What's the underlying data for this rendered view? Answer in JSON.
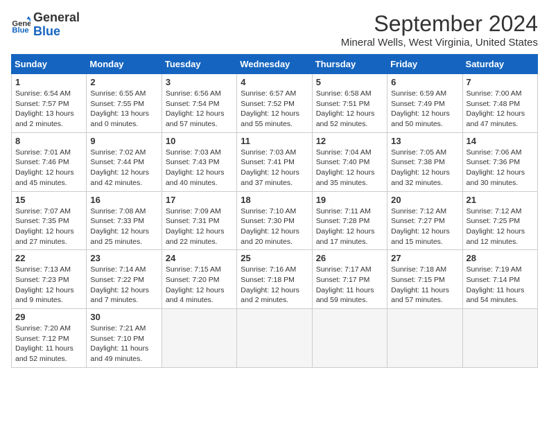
{
  "logo": {
    "line1": "General",
    "line2": "Blue"
  },
  "title": "September 2024",
  "subtitle": "Mineral Wells, West Virginia, United States",
  "days_of_week": [
    "Sunday",
    "Monday",
    "Tuesday",
    "Wednesday",
    "Thursday",
    "Friday",
    "Saturday"
  ],
  "weeks": [
    [
      {
        "day": "1",
        "info": "Sunrise: 6:54 AM\nSunset: 7:57 PM\nDaylight: 13 hours\nand 2 minutes."
      },
      {
        "day": "2",
        "info": "Sunrise: 6:55 AM\nSunset: 7:55 PM\nDaylight: 13 hours\nand 0 minutes."
      },
      {
        "day": "3",
        "info": "Sunrise: 6:56 AM\nSunset: 7:54 PM\nDaylight: 12 hours\nand 57 minutes."
      },
      {
        "day": "4",
        "info": "Sunrise: 6:57 AM\nSunset: 7:52 PM\nDaylight: 12 hours\nand 55 minutes."
      },
      {
        "day": "5",
        "info": "Sunrise: 6:58 AM\nSunset: 7:51 PM\nDaylight: 12 hours\nand 52 minutes."
      },
      {
        "day": "6",
        "info": "Sunrise: 6:59 AM\nSunset: 7:49 PM\nDaylight: 12 hours\nand 50 minutes."
      },
      {
        "day": "7",
        "info": "Sunrise: 7:00 AM\nSunset: 7:48 PM\nDaylight: 12 hours\nand 47 minutes."
      }
    ],
    [
      {
        "day": "8",
        "info": "Sunrise: 7:01 AM\nSunset: 7:46 PM\nDaylight: 12 hours\nand 45 minutes."
      },
      {
        "day": "9",
        "info": "Sunrise: 7:02 AM\nSunset: 7:44 PM\nDaylight: 12 hours\nand 42 minutes."
      },
      {
        "day": "10",
        "info": "Sunrise: 7:03 AM\nSunset: 7:43 PM\nDaylight: 12 hours\nand 40 minutes."
      },
      {
        "day": "11",
        "info": "Sunrise: 7:03 AM\nSunset: 7:41 PM\nDaylight: 12 hours\nand 37 minutes."
      },
      {
        "day": "12",
        "info": "Sunrise: 7:04 AM\nSunset: 7:40 PM\nDaylight: 12 hours\nand 35 minutes."
      },
      {
        "day": "13",
        "info": "Sunrise: 7:05 AM\nSunset: 7:38 PM\nDaylight: 12 hours\nand 32 minutes."
      },
      {
        "day": "14",
        "info": "Sunrise: 7:06 AM\nSunset: 7:36 PM\nDaylight: 12 hours\nand 30 minutes."
      }
    ],
    [
      {
        "day": "15",
        "info": "Sunrise: 7:07 AM\nSunset: 7:35 PM\nDaylight: 12 hours\nand 27 minutes."
      },
      {
        "day": "16",
        "info": "Sunrise: 7:08 AM\nSunset: 7:33 PM\nDaylight: 12 hours\nand 25 minutes."
      },
      {
        "day": "17",
        "info": "Sunrise: 7:09 AM\nSunset: 7:31 PM\nDaylight: 12 hours\nand 22 minutes."
      },
      {
        "day": "18",
        "info": "Sunrise: 7:10 AM\nSunset: 7:30 PM\nDaylight: 12 hours\nand 20 minutes."
      },
      {
        "day": "19",
        "info": "Sunrise: 7:11 AM\nSunset: 7:28 PM\nDaylight: 12 hours\nand 17 minutes."
      },
      {
        "day": "20",
        "info": "Sunrise: 7:12 AM\nSunset: 7:27 PM\nDaylight: 12 hours\nand 15 minutes."
      },
      {
        "day": "21",
        "info": "Sunrise: 7:12 AM\nSunset: 7:25 PM\nDaylight: 12 hours\nand 12 minutes."
      }
    ],
    [
      {
        "day": "22",
        "info": "Sunrise: 7:13 AM\nSunset: 7:23 PM\nDaylight: 12 hours\nand 9 minutes."
      },
      {
        "day": "23",
        "info": "Sunrise: 7:14 AM\nSunset: 7:22 PM\nDaylight: 12 hours\nand 7 minutes."
      },
      {
        "day": "24",
        "info": "Sunrise: 7:15 AM\nSunset: 7:20 PM\nDaylight: 12 hours\nand 4 minutes."
      },
      {
        "day": "25",
        "info": "Sunrise: 7:16 AM\nSunset: 7:18 PM\nDaylight: 12 hours\nand 2 minutes."
      },
      {
        "day": "26",
        "info": "Sunrise: 7:17 AM\nSunset: 7:17 PM\nDaylight: 11 hours\nand 59 minutes."
      },
      {
        "day": "27",
        "info": "Sunrise: 7:18 AM\nSunset: 7:15 PM\nDaylight: 11 hours\nand 57 minutes."
      },
      {
        "day": "28",
        "info": "Sunrise: 7:19 AM\nSunset: 7:14 PM\nDaylight: 11 hours\nand 54 minutes."
      }
    ],
    [
      {
        "day": "29",
        "info": "Sunrise: 7:20 AM\nSunset: 7:12 PM\nDaylight: 11 hours\nand 52 minutes."
      },
      {
        "day": "30",
        "info": "Sunrise: 7:21 AM\nSunset: 7:10 PM\nDaylight: 11 hours\nand 49 minutes."
      },
      {
        "day": "",
        "info": ""
      },
      {
        "day": "",
        "info": ""
      },
      {
        "day": "",
        "info": ""
      },
      {
        "day": "",
        "info": ""
      },
      {
        "day": "",
        "info": ""
      }
    ]
  ]
}
